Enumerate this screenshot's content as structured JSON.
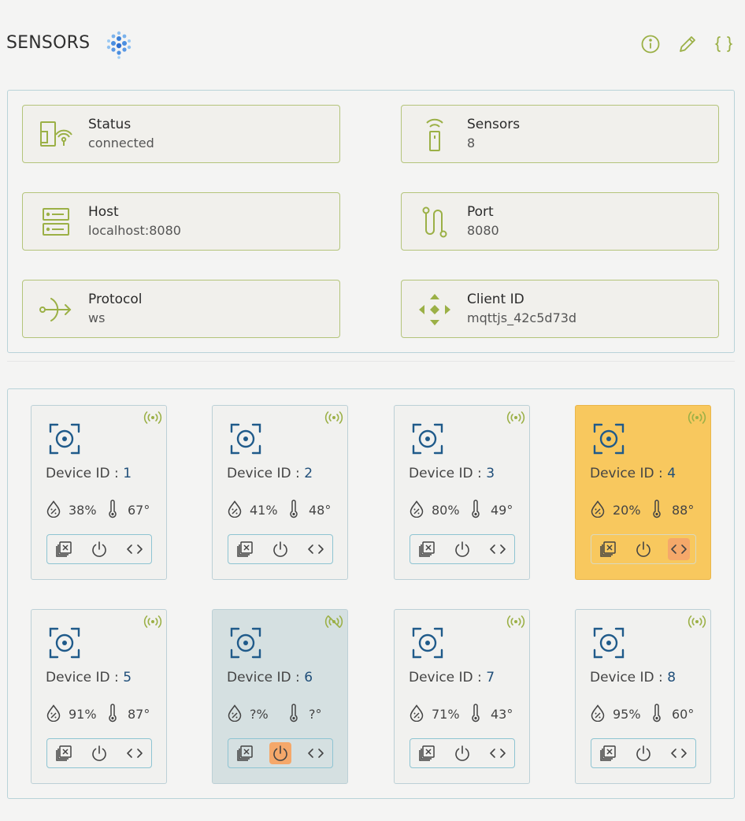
{
  "header": {
    "title": "SENSORS",
    "logo_icon": "sensor-cluster-icon",
    "buttons": [
      {
        "icon": "info-icon"
      },
      {
        "icon": "pencil-icon"
      },
      {
        "icon": "braces-icon"
      }
    ]
  },
  "colors": {
    "accent_green": "#9bb046",
    "device_blue": "#1f4e79",
    "alert_bg": "#f8c85e",
    "offline_bg": "#d5e0e1",
    "action_highlight": "#f5a86a"
  },
  "info": {
    "status": {
      "label": "Status",
      "value": "connected",
      "icon": "connection-icon"
    },
    "sensors": {
      "label": "Sensors",
      "value": "8",
      "icon": "antenna-icon"
    },
    "host": {
      "label": "Host",
      "value": "localhost:8080",
      "icon": "server-icon"
    },
    "port": {
      "label": "Port",
      "value": "8080",
      "icon": "route-icon"
    },
    "protocol": {
      "label": "Protocol",
      "value": "ws",
      "icon": "protocol-arrow-icon"
    },
    "client": {
      "label": "Client ID",
      "value": "mqttjs_42c5d73d",
      "icon": "diamond-arrows-icon"
    }
  },
  "devices": [
    {
      "label": "Device ID :",
      "id": "1",
      "humidity": "38%",
      "temperature": "67°",
      "state": "online"
    },
    {
      "label": "Device ID :",
      "id": "2",
      "humidity": "41%",
      "temperature": "48°",
      "state": "online"
    },
    {
      "label": "Device ID :",
      "id": "3",
      "humidity": "80%",
      "temperature": "49°",
      "state": "online"
    },
    {
      "label": "Device ID :",
      "id": "4",
      "humidity": "20%",
      "temperature": "88°",
      "state": "alert"
    },
    {
      "label": "Device ID :",
      "id": "5",
      "humidity": "91%",
      "temperature": "87°",
      "state": "online"
    },
    {
      "label": "Device ID :",
      "id": "6",
      "humidity": "?%",
      "temperature": "?°",
      "state": "offline"
    },
    {
      "label": "Device ID :",
      "id": "7",
      "humidity": "71%",
      "temperature": "43°",
      "state": "online"
    },
    {
      "label": "Device ID :",
      "id": "8",
      "humidity": "95%",
      "temperature": "60°",
      "state": "online"
    }
  ]
}
